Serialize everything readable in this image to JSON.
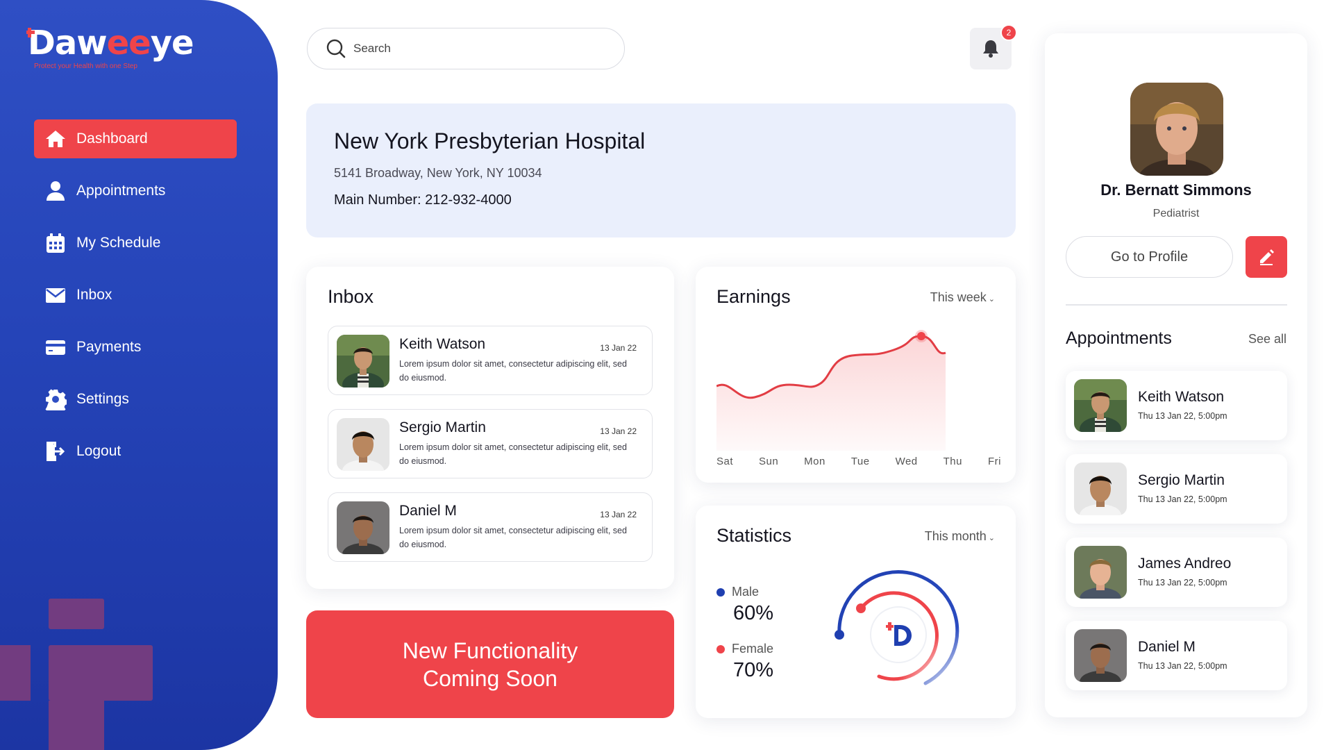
{
  "brand": {
    "name_part1": "Daw",
    "name_part2": "ee",
    "name_part3": "ye",
    "tagline": "Protect your Health with one Step"
  },
  "nav": {
    "items": [
      {
        "label": "Dashboard",
        "icon": "home-icon",
        "active": true
      },
      {
        "label": "Appointments",
        "icon": "user-icon"
      },
      {
        "label": "My Schedule",
        "icon": "calendar-icon"
      },
      {
        "label": "Inbox",
        "icon": "mail-icon"
      },
      {
        "label": "Payments",
        "icon": "credit-card-icon"
      },
      {
        "label": "Settings",
        "icon": "gear-icon"
      },
      {
        "label": "Logout",
        "icon": "logout-icon"
      }
    ]
  },
  "search": {
    "placeholder": "Search"
  },
  "notifications": {
    "count": "2"
  },
  "hospital": {
    "name": "New York Presbyterian Hospital",
    "address": "5141 Broadway, New York, NY 10034",
    "phone": "Main Number: 212-932-4000"
  },
  "inbox": {
    "title": "Inbox",
    "messages": [
      {
        "name": "Keith Watson",
        "date": "13 Jan 22",
        "text": "Lorem ipsum dolor sit amet, consectetur adipiscing elit, sed do eiusmod."
      },
      {
        "name": "Sergio Martin",
        "date": "13 Jan 22",
        "text": "Lorem ipsum dolor sit amet, consectetur adipiscing elit, sed do eiusmod."
      },
      {
        "name": "Daniel M",
        "date": "13 Jan 22",
        "text": "Lorem ipsum dolor sit amet, consectetur adipiscing elit, sed do eiusmod."
      }
    ]
  },
  "banner": {
    "line1": "New Functionality",
    "line2": "Coming Soon"
  },
  "earnings": {
    "title": "Earnings",
    "period": "This week",
    "days": [
      "Sat",
      "Sun",
      "Mon",
      "Tue",
      "Wed",
      "Thu",
      "Fri"
    ]
  },
  "statistics": {
    "title": "Statistics",
    "period": "This month",
    "male_label": "Male",
    "male_value": "60%",
    "female_label": "Female",
    "female_value": "70%"
  },
  "profile": {
    "name": "Dr. Bernatt Simmons",
    "role": "Pediatrist",
    "go_profile_label": "Go to Profile"
  },
  "appointments": {
    "title": "Appointments",
    "see_all": "See all",
    "items": [
      {
        "name": "Keith Watson",
        "time": "Thu 13 Jan 22, 5:00pm"
      },
      {
        "name": "Sergio Martin",
        "time": "Thu 13 Jan 22, 5:00pm"
      },
      {
        "name": "James Andreo",
        "time": "Thu 13 Jan 22, 5:00pm"
      },
      {
        "name": "Daniel M",
        "time": "Thu 13 Jan 22, 5:00pm"
      }
    ]
  },
  "colors": {
    "sidebar": "#2544b8",
    "accent": "#ef444a",
    "banner_bg": "#eaeffc",
    "male": "#1f3fb0",
    "female": "#ef444a"
  }
}
